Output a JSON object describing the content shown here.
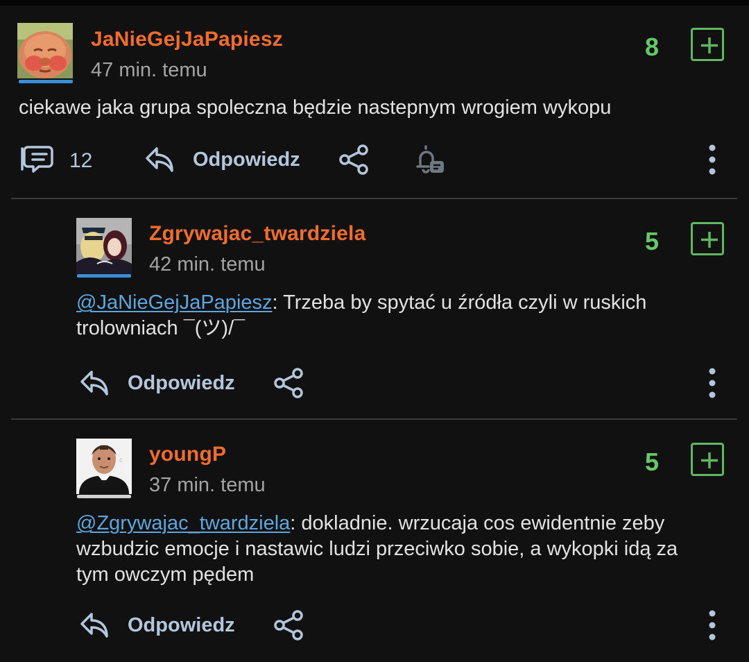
{
  "comments": [
    {
      "username": "JaNieGejJaPapiesz",
      "time": "47 min. temu",
      "score": "8",
      "body": "ciekawe  jaka grupa spoleczna będzie nastepnym wrogiem wykopu",
      "replies_count": "12",
      "reply_label": "Odpowiedz"
    },
    {
      "username": "Zgrywajac_twardziela",
      "time": "42 min. temu",
      "score": "5",
      "mention": "@JaNieGejJaPapiesz",
      "body_line1": ": Trzeba by spytać u źródła czyli w ruskich",
      "body_line2": "trolowniach ¯(ツ)/¯",
      "reply_label": "Odpowiedz"
    },
    {
      "username": "youngP",
      "time": "37 min. temu",
      "score": "5",
      "mention": "@Zgrywajac_twardziela",
      "body_line1": ": dokladnie. wrzucaja cos ewidentnie zeby",
      "body_line2": "wzbudzic emocje i nastawic ludzi przeciwko sobie, a wykopki idą za",
      "body_line3": "tym owczym pędem",
      "reply_label": "Odpowiedz"
    }
  ],
  "colors": {
    "username": "#f26c2e",
    "score": "#67c86a",
    "mention": "#5ea7de",
    "action": "#b3c6dc",
    "background": "#111111"
  },
  "icons": [
    "comments-icon",
    "reply-icon",
    "share-icon",
    "notification-bell-icon",
    "more-options-icon",
    "upvote-plus-icon"
  ]
}
